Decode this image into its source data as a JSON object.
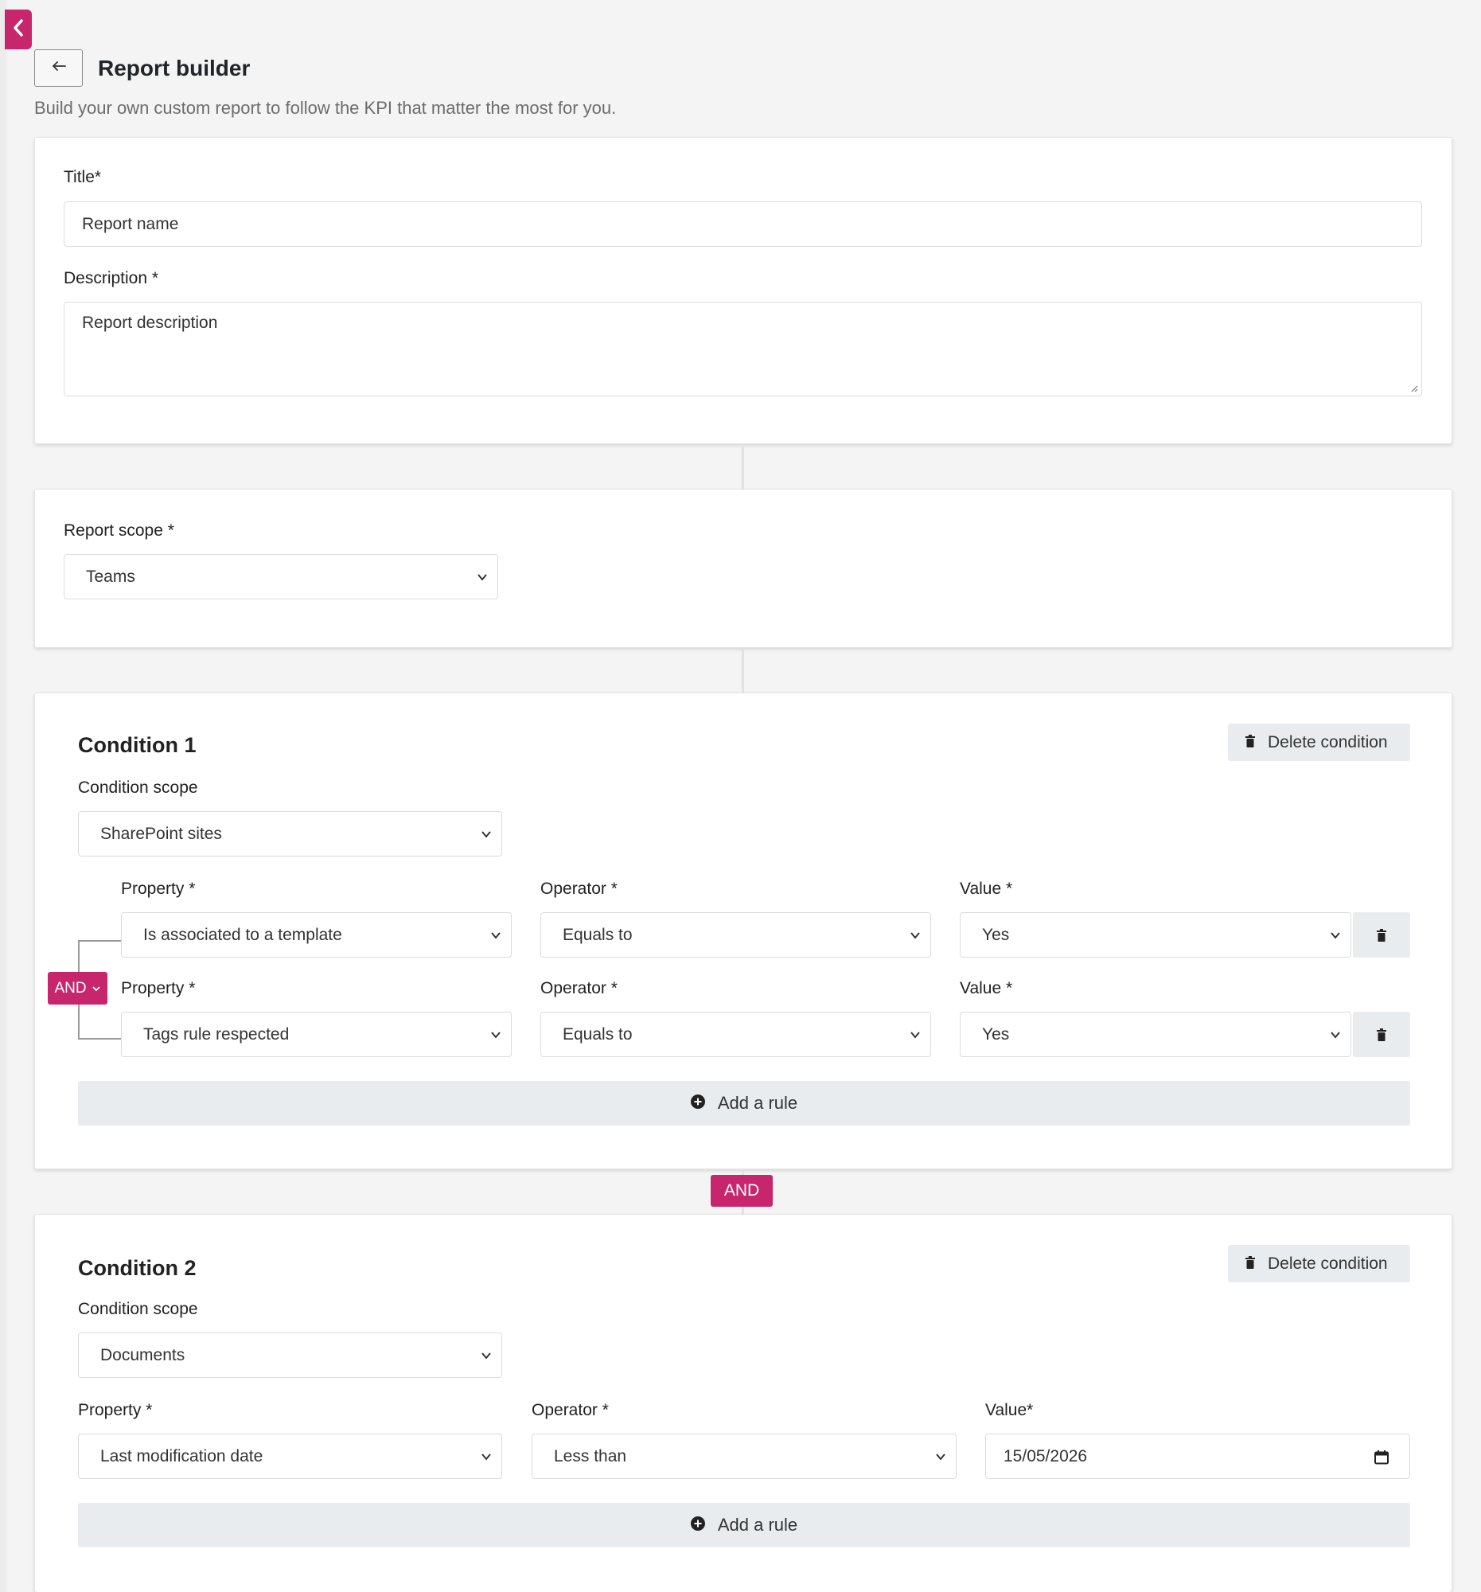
{
  "header": {
    "title": "Report builder",
    "subtitle": "Build your own custom report to follow the KPI that matter the most for you."
  },
  "icons": {
    "collapse": "chevron-left-icon",
    "back": "arrow-left-icon",
    "trash": "trash-icon",
    "add": "plus-circle-icon",
    "calendar": "calendar-icon",
    "dropdown": "chevron-down-icon"
  },
  "colors": {
    "accent": "#c8266c",
    "button_bg": "#e9ecef"
  },
  "general": {
    "title_label": "Title*",
    "title_placeholder": "Report name",
    "description_label": "Description *",
    "description_placeholder": "Report description"
  },
  "scope": {
    "label": "Report scope *",
    "value": "Teams"
  },
  "condition1": {
    "title": "Condition 1",
    "delete_label": "Delete condition",
    "scope_label": "Condition scope",
    "scope_value": "SharePoint sites",
    "logic": "AND",
    "rules": [
      {
        "property_label": "Property *",
        "property": "Is associated to a template",
        "operator_label": "Operator *",
        "operator": "Equals to",
        "value_label": "Value *",
        "value": "Yes"
      },
      {
        "property_label": "Property *",
        "property": "Tags rule respected",
        "operator_label": "Operator *",
        "operator": "Equals to",
        "value_label": "Value *",
        "value": "Yes"
      }
    ],
    "add_rule_label": "Add a rule"
  },
  "joiner": "AND",
  "condition2": {
    "title": "Condition 2",
    "delete_label": "Delete condition",
    "scope_label": "Condition scope",
    "scope_value": "Documents",
    "rules": [
      {
        "property_label": "Property *",
        "property": "Last modification date",
        "operator_label": "Operator *",
        "operator": "Less than",
        "value_label": "Value*",
        "value": "15/05/2026"
      }
    ],
    "add_rule_label": "Add a rule"
  }
}
